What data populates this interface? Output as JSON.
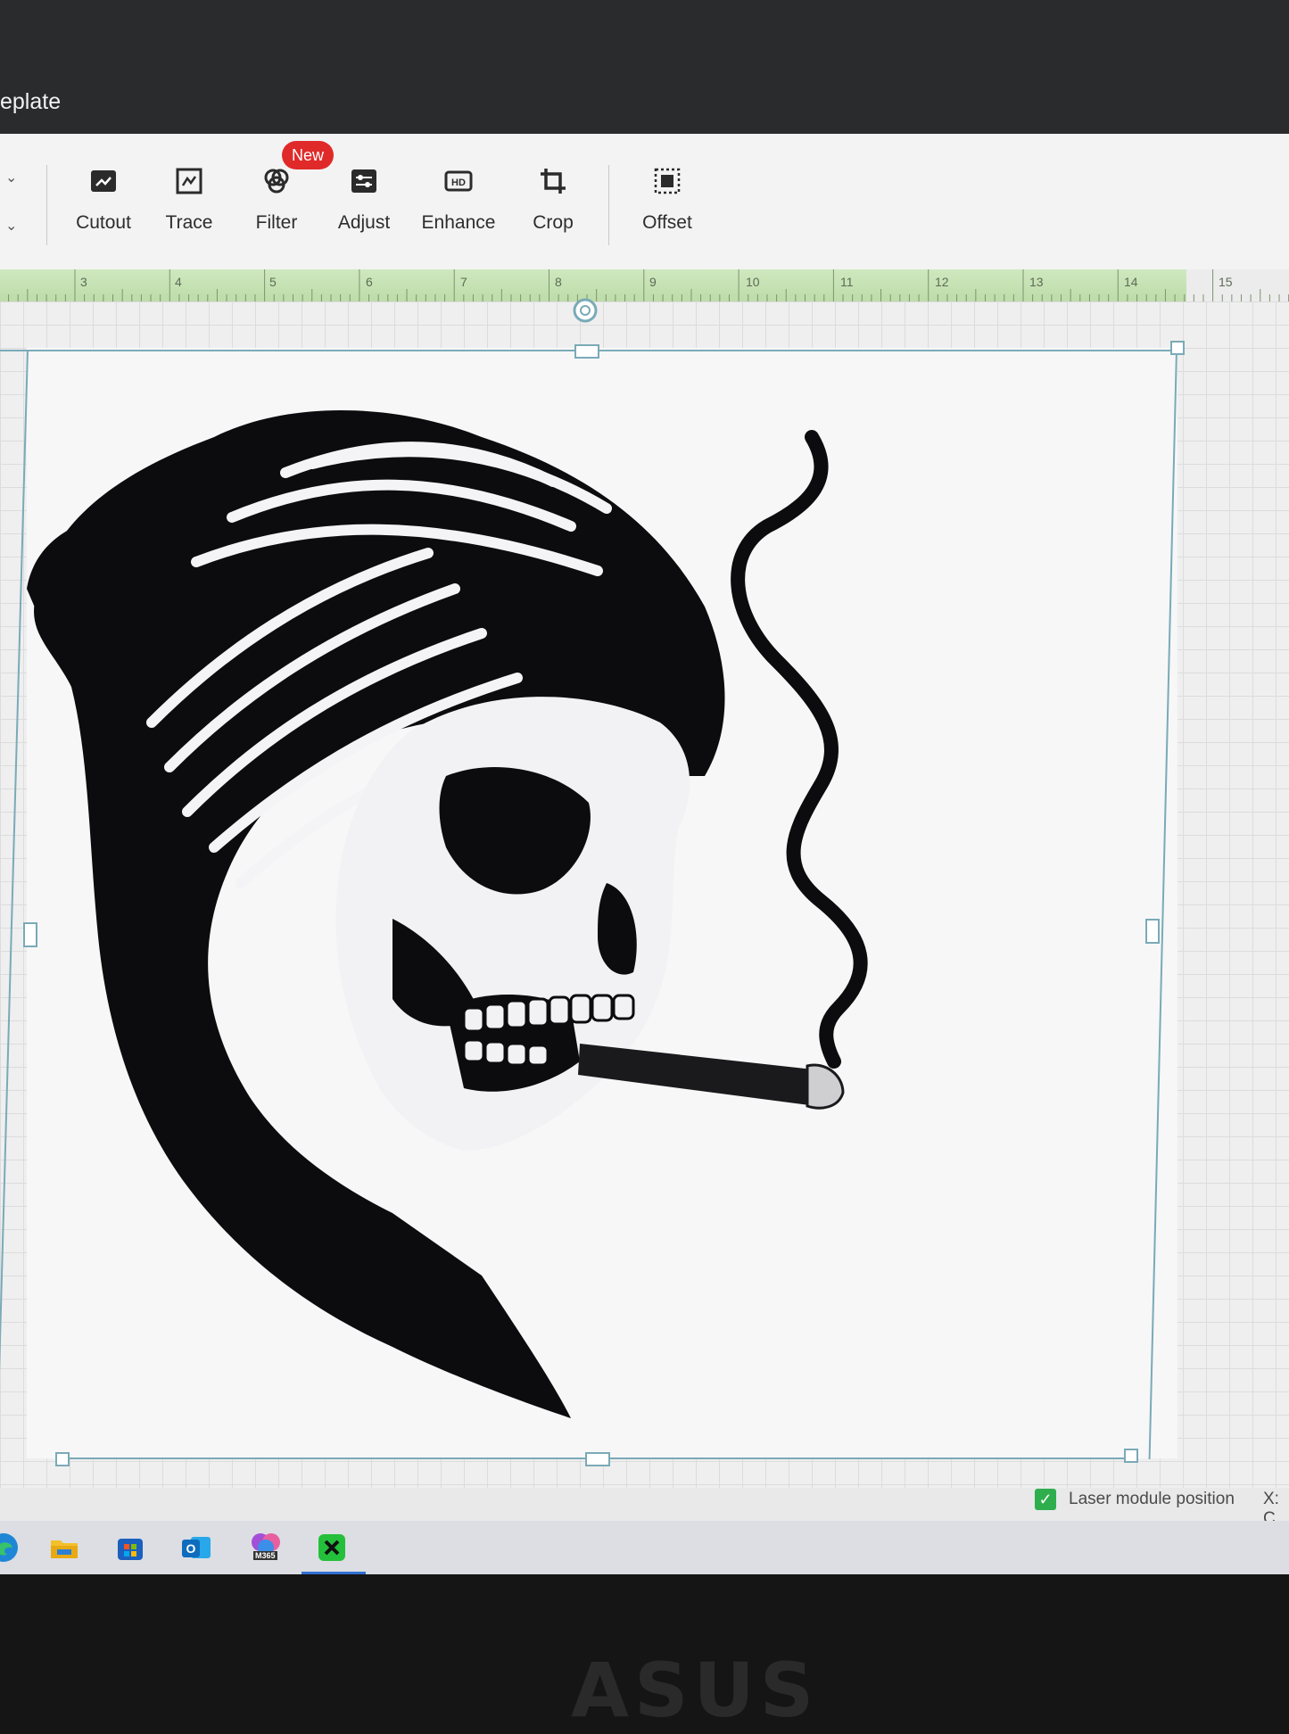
{
  "window": {
    "title": "eplate"
  },
  "toolbar": {
    "tools": [
      {
        "label": "Cutout",
        "icon": "cutout-icon"
      },
      {
        "label": "Trace",
        "icon": "trace-icon"
      },
      {
        "label": "Filter",
        "icon": "filter-icon",
        "badge": "New"
      },
      {
        "label": "Adjust",
        "icon": "adjust-icon"
      },
      {
        "label": "Enhance",
        "icon": "hd-icon"
      },
      {
        "label": "Crop",
        "icon": "crop-icon"
      },
      {
        "label": "Offset",
        "icon": "offset-icon"
      }
    ]
  },
  "ruler": {
    "numbers": [
      "3",
      "4",
      "5",
      "6",
      "7",
      "8",
      "9",
      "10",
      "11",
      "12",
      "13",
      "14",
      "15"
    ]
  },
  "canvas": {
    "image_subject": "skull-with-beanie-and-cigar"
  },
  "status": {
    "laser_module_label": "Laser module position",
    "laser_module_checked": true,
    "x_label": "X: C"
  },
  "taskbar": {
    "apps": [
      "edge-icon",
      "file-explorer-icon",
      "store-icon",
      "outlook-icon",
      "m365-icon",
      "xtool-icon"
    ],
    "m365_label": "M365"
  },
  "bezel": {
    "logo": "ASUS"
  },
  "colors": {
    "accent_red": "#e02a2a",
    "selection": "#7aaab7",
    "ruler_green": "#c7e3b3",
    "check_green": "#2fae4e"
  }
}
